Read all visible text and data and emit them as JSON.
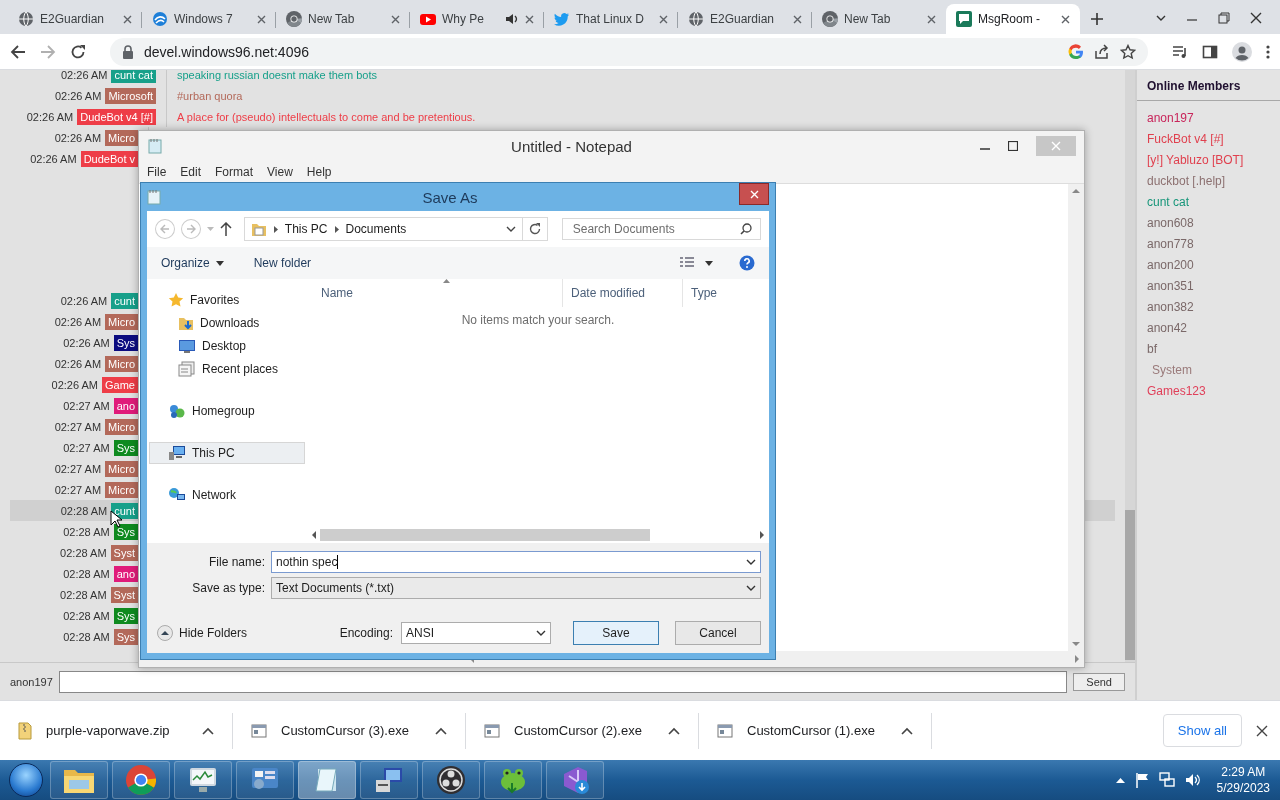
{
  "browser": {
    "tabs": [
      {
        "title": "E2Guardian",
        "audio": false,
        "selected": false
      },
      {
        "title": "Windows 7",
        "audio": false,
        "selected": false
      },
      {
        "title": "New Tab",
        "audio": false,
        "selected": false
      },
      {
        "title": "Why Pe",
        "audio": true,
        "selected": false
      },
      {
        "title": "That Linux D",
        "audio": false,
        "selected": false
      },
      {
        "title": "E2Guardian",
        "audio": false,
        "selected": false
      },
      {
        "title": "New Tab",
        "audio": false,
        "selected": false
      },
      {
        "title": "MsgRoom -",
        "audio": false,
        "selected": true
      }
    ],
    "url": "devel.windows96.net:4096"
  },
  "chat": {
    "messages": [
      {
        "time": "02:26 AM",
        "user": "cunt cat",
        "color": "#17a08a",
        "text": "speaking russian doesnt make them bots",
        "highlighted": false
      },
      {
        "time": "02:26 AM",
        "user": "Microsoft",
        "color": "#b3695a",
        "text": "#urban quora",
        "highlighted": false
      },
      {
        "time": "02:26 AM",
        "user": "DudeBot v4 [#]",
        "color": "#ee3d47",
        "text": "A place for (pseudo) intellectuals to come and be pretentious.",
        "highlighted": false
      },
      {
        "time": "02:26 AM",
        "user": "Micro",
        "color": "#b3695a",
        "highlighted": false
      },
      {
        "time": "02:26 AM",
        "user": "DudeBot v",
        "color": "#ee3d47",
        "highlighted": false
      },
      {
        "time": "02:26 AM",
        "user": "cunt",
        "color": "#17a08a",
        "highlighted": false
      },
      {
        "time": "02:26 AM",
        "user": "Micro",
        "color": "#b3695a",
        "highlighted": false
      },
      {
        "time": "02:26 AM",
        "user": "Sys",
        "color": "#0c0c80",
        "highlighted": false
      },
      {
        "time": "02:26 AM",
        "user": "Micro",
        "color": "#b3695a",
        "highlighted": false
      },
      {
        "time": "02:26 AM",
        "user": "Game",
        "color": "#ee3d47",
        "highlighted": false
      },
      {
        "time": "02:27 AM",
        "user": "ano",
        "color": "#e01b7a",
        "highlighted": false
      },
      {
        "time": "02:27 AM",
        "user": "Micro",
        "color": "#b3695a",
        "highlighted": false
      },
      {
        "time": "02:27 AM",
        "user": "Sys",
        "color": "#0f8a1f",
        "highlighted": false
      },
      {
        "time": "02:27 AM",
        "user": "Micro",
        "color": "#b3695a",
        "highlighted": false
      },
      {
        "time": "02:27 AM",
        "user": "Micro",
        "color": "#b3695a",
        "highlighted": false
      },
      {
        "time": "02:28 AM",
        "user": "cunt",
        "color": "#17a08a",
        "highlighted": true
      },
      {
        "time": "02:28 AM",
        "user": "Sys",
        "color": "#0f8a1f",
        "highlighted": false
      },
      {
        "time": "02:28 AM",
        "user": "Syst",
        "color": "#b3695a",
        "highlighted": false
      },
      {
        "time": "02:28 AM",
        "user": "ano",
        "color": "#e01b7a",
        "highlighted": false
      },
      {
        "time": "02:28 AM",
        "user": "Syst",
        "color": "#b3695a",
        "highlighted": false
      },
      {
        "time": "02:28 AM",
        "user": "Sys",
        "color": "#0f8a1f",
        "highlighted": false
      },
      {
        "time": "02:28 AM",
        "user": "Sys",
        "color": "#b3695a",
        "highlighted": false
      }
    ],
    "nickname": "anon197",
    "send": "Send"
  },
  "members": {
    "title": "Online Members",
    "items": [
      {
        "name": "anon197",
        "color": "#c8245a",
        "indented": false
      },
      {
        "name": "FuckBot v4 [#]",
        "color": "#e0404e",
        "indented": false
      },
      {
        "name": "[y!] Yabluzo [BOT]",
        "color": "#e0404e",
        "indented": false
      },
      {
        "name": "duckbot [.help]",
        "color": "#8c7070",
        "indented": false
      },
      {
        "name": "cunt cat",
        "color": "#17967a",
        "indented": false
      },
      {
        "name": "anon608",
        "color": "#7a6868",
        "indented": false
      },
      {
        "name": "anon778",
        "color": "#7a6868",
        "indented": false
      },
      {
        "name": "anon200",
        "color": "#7a6868",
        "indented": false
      },
      {
        "name": "anon351",
        "color": "#7a6868",
        "indented": false
      },
      {
        "name": "anon382",
        "color": "#7a6868",
        "indented": false
      },
      {
        "name": "anon42",
        "color": "#7a6868",
        "indented": false
      },
      {
        "name": "bf",
        "color": "#7a6868",
        "indented": false
      },
      {
        "name": "System",
        "color": "#9a7a7a",
        "indented": true
      },
      {
        "name": "Games123",
        "color": "#e0405a",
        "indented": false
      }
    ]
  },
  "notepad": {
    "title": "Untitled - Notepad",
    "menu": [
      "File",
      "Edit",
      "Format",
      "View",
      "Help"
    ]
  },
  "dialog": {
    "title": "Save As",
    "path": [
      "This PC",
      "Documents"
    ],
    "search_placeholder": "Search Documents",
    "commands": [
      "Organize",
      "New folder"
    ],
    "nav": [
      {
        "label": "Favorites",
        "selected": false,
        "children": [
          {
            "label": "Downloads",
            "selected": false
          },
          {
            "label": "Desktop",
            "selected": false
          },
          {
            "label": "Recent places",
            "selected": false
          }
        ]
      },
      {
        "label": "Homegroup",
        "selected": false
      },
      {
        "label": "This PC",
        "selected": true
      },
      {
        "label": "Network",
        "selected": false
      }
    ],
    "columns": [
      "Name",
      "Date modified",
      "Type"
    ],
    "empty_message": "No items match your search.",
    "file_name_label": "File name:",
    "file_name": "nothin spec",
    "type_label": "Save as type:",
    "type": "Text Documents (*.txt)",
    "hide_folders": "Hide Folders",
    "encoding_label": "Encoding:",
    "encoding": "ANSI",
    "buttons": [
      "Save",
      "Cancel"
    ]
  },
  "downloads": {
    "items": [
      {
        "name": "purple-vaporwave.zip"
      },
      {
        "name": "CustomCursor (3).exe"
      },
      {
        "name": "CustomCursor (2).exe"
      },
      {
        "name": "CustomCursor (1).exe"
      }
    ],
    "show_all": "Show all"
  },
  "taskbar": {
    "apps": [
      {
        "active": false
      },
      {
        "active": false
      },
      {
        "active": false
      },
      {
        "active": false
      },
      {
        "active": true
      },
      {
        "active": false
      },
      {
        "active": false
      },
      {
        "active": false
      },
      {
        "active": false
      }
    ],
    "time": "2:29 AM",
    "date": "5/29/2023"
  }
}
